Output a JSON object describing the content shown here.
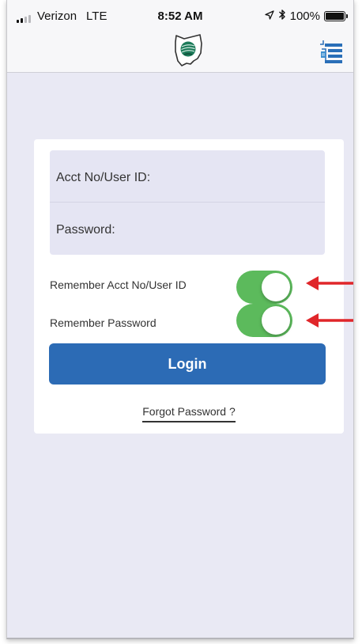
{
  "status_bar": {
    "carrier": "Verizon",
    "network": "LTE",
    "time": "8:52 AM",
    "battery": "100%",
    "battery_level": 1.0,
    "icons": [
      "signal-icon",
      "location-arrow-icon",
      "bluetooth-icon",
      "battery-icon"
    ]
  },
  "nav": {
    "logo_icon": "ohio-state-logo-icon",
    "menu_icon": "menu-list-icon"
  },
  "login_form": {
    "user_id_placeholder": "Acct No/User ID:",
    "password_placeholder": "Password:",
    "remember_user_label": "Remember Acct No/User ID",
    "remember_user_on": true,
    "remember_password_label": "Remember Password",
    "remember_password_on": true,
    "login_label": "Login",
    "forgot_password_label": "Forgot Password ?"
  },
  "colors": {
    "background": "#e9e9f4",
    "accent_blue": "#2c6bb5",
    "toggle_green": "#5cba5c",
    "annotation_arrow": "#e0262a"
  }
}
